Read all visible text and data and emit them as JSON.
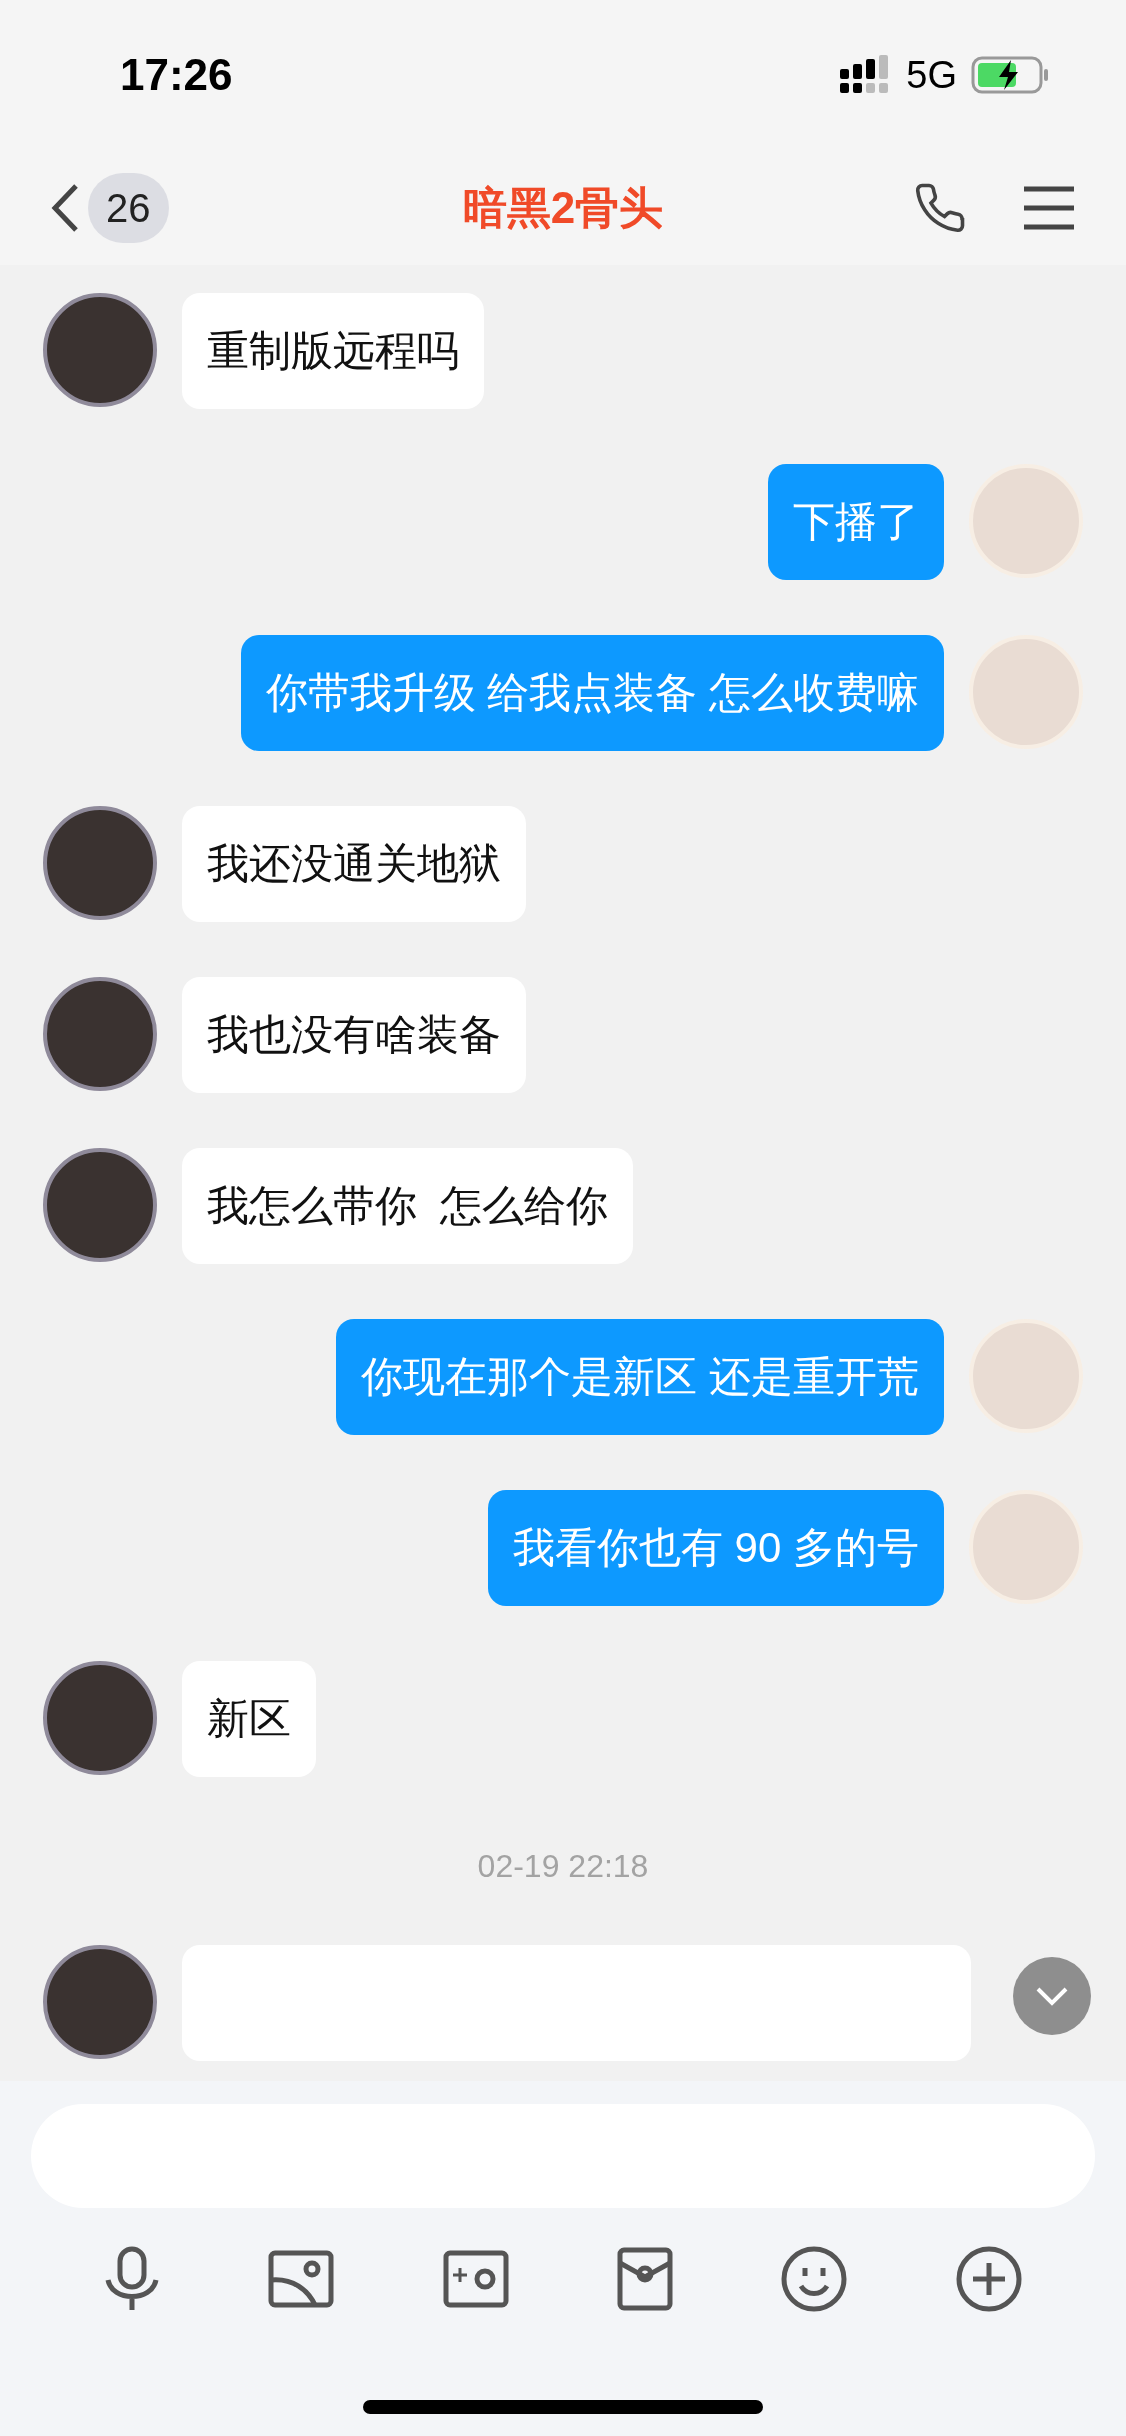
{
  "status_bar": {
    "time": "17:26",
    "network": "5G"
  },
  "header": {
    "unread_count": "26",
    "title": "暗黑2骨头"
  },
  "messages": [
    {
      "kind": "received",
      "text": "重制版远程吗"
    },
    {
      "kind": "sent",
      "text": "下播了"
    },
    {
      "kind": "sent",
      "text": "你带我升级 给我点装备 怎么收费嘛"
    },
    {
      "kind": "received",
      "text": "我还没通关地狱"
    },
    {
      "kind": "received",
      "text": "我也没有啥装备"
    },
    {
      "kind": "received",
      "text": "我怎么带你  怎么给你"
    },
    {
      "kind": "sent",
      "text": "你现在那个是新区 还是重开荒"
    },
    {
      "kind": "sent",
      "text": "我看你也有 90 多的号"
    },
    {
      "kind": "received",
      "text": "新区"
    },
    {
      "kind": "timestamp",
      "text": "02-19 22:18"
    },
    {
      "kind": "received_cut"
    }
  ]
}
